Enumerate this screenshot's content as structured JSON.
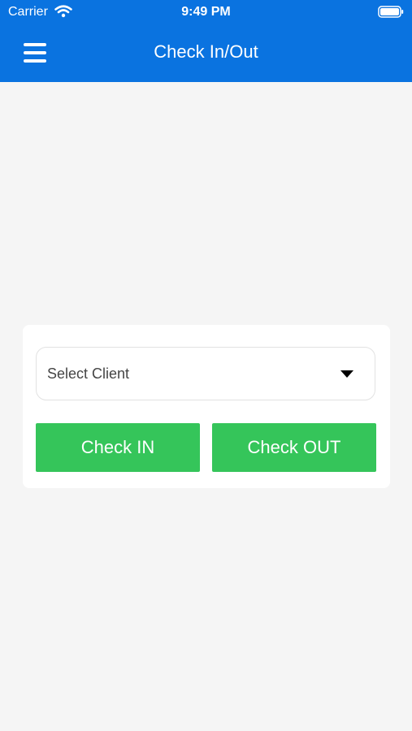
{
  "status_bar": {
    "carrier": "Carrier",
    "time": "9:49 PM"
  },
  "header": {
    "title": "Check In/Out",
    "background": "#0a73e0"
  },
  "form": {
    "client_select": {
      "label": "Select Client"
    },
    "check_in_label": "Check IN",
    "check_out_label": "Check OUT",
    "button_color": "#35c55a"
  },
  "icons": {
    "menu": "hamburger-menu-icon",
    "wifi": "wifi-icon",
    "battery": "battery-icon",
    "dropdown": "dropdown-arrow-icon"
  }
}
